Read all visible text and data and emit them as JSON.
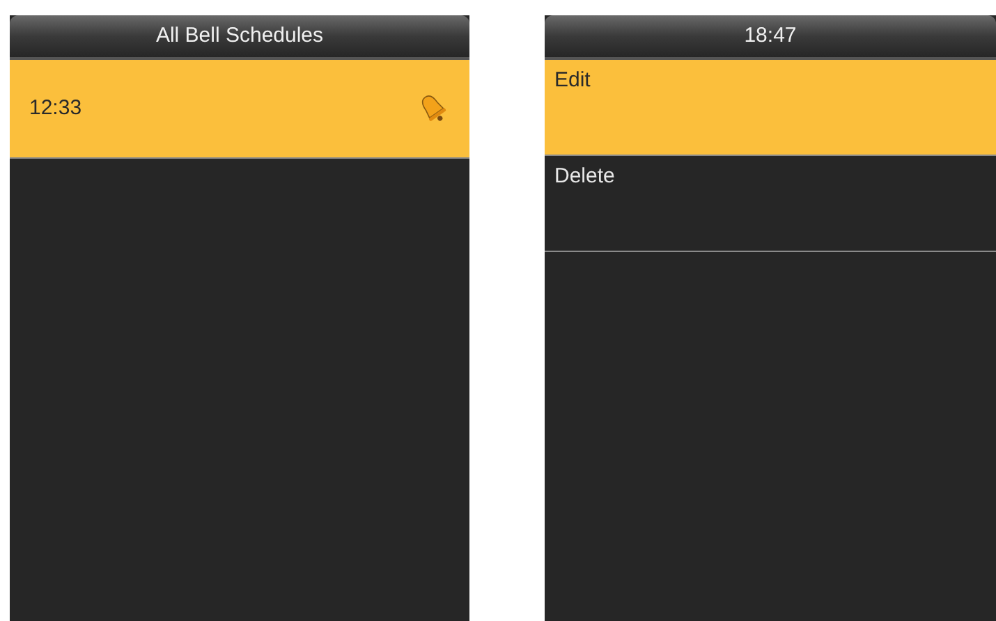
{
  "screens": [
    {
      "title": "All Bell Schedules",
      "items": [
        {
          "kind": "schedule",
          "label": "12:33",
          "selected": true
        }
      ]
    },
    {
      "title": "18:47",
      "items": [
        {
          "kind": "option",
          "label": "Edit",
          "selected": true
        },
        {
          "kind": "option",
          "label": "Delete",
          "selected": false
        }
      ]
    }
  ]
}
